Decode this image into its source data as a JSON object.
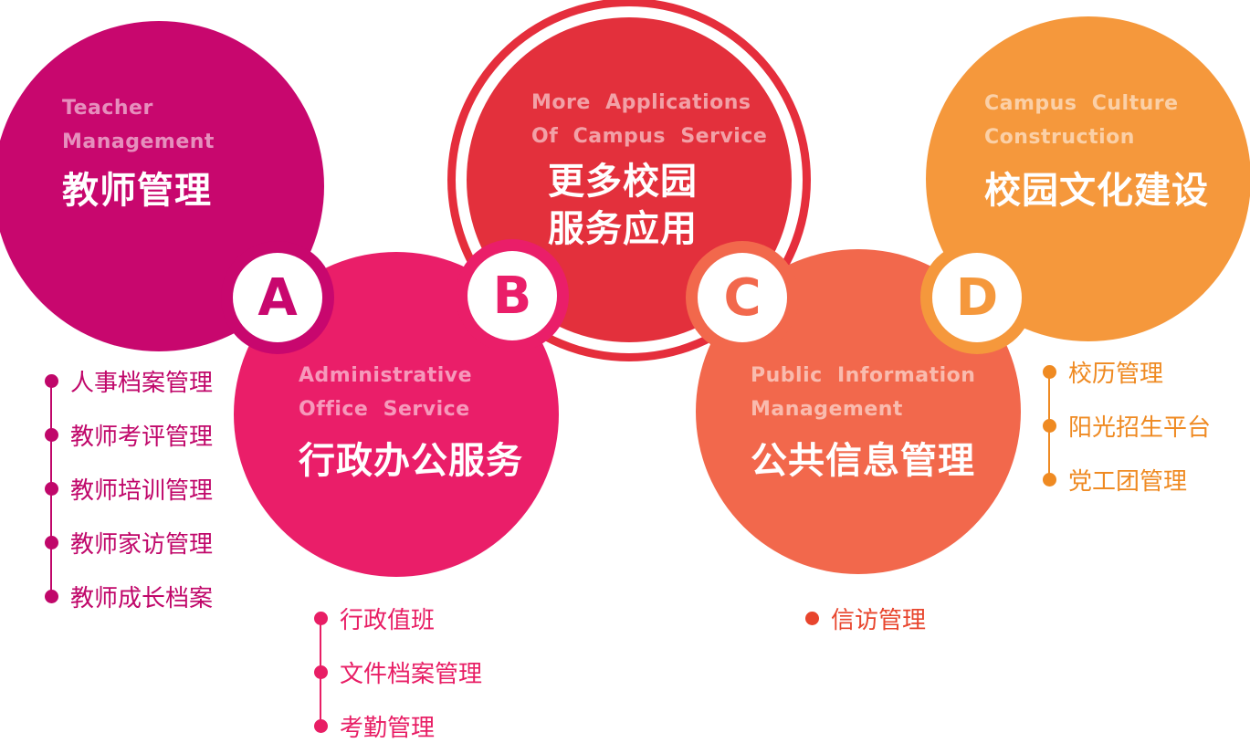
{
  "colors": {
    "a": "#c8076e",
    "b": "#ea1e69",
    "c_outer": "#e52e3c",
    "c": "#e3303c",
    "d": "#f2684c",
    "e": "#f5983c",
    "list_a": "#c0076a",
    "list_b": "#e81e65",
    "list_c": "#e8452d",
    "list_d": "#ef8a22"
  },
  "sections": {
    "a": {
      "en_lines": [
        "Teacher",
        "Management"
      ],
      "title_lines": [
        "教师管理"
      ],
      "badge": "A",
      "items": [
        "人事档案管理",
        "教师考评管理",
        "教师培训管理",
        "教师家访管理",
        "教师成长档案"
      ]
    },
    "b": {
      "en_lines": [
        "Administrative",
        "Office  Service"
      ],
      "title_lines": [
        "行政办公服务"
      ],
      "badge": "B",
      "items": [
        "行政值班",
        "文件档案管理",
        "考勤管理"
      ]
    },
    "c": {
      "en_lines": [
        "More  Applications",
        "Of  Campus  Service"
      ],
      "title_lines": [
        "更多校园",
        "服务应用"
      ],
      "badge": "C"
    },
    "d": {
      "en_lines": [
        "Public  Information",
        "Management"
      ],
      "title_lines": [
        "公共信息管理"
      ],
      "badge": "D",
      "items": [
        "信访管理"
      ]
    },
    "e": {
      "en_lines": [
        "Campus  Culture",
        "Construction"
      ],
      "title_lines": [
        "校园文化建设"
      ],
      "items": [
        "校历管理",
        "阳光招生平台",
        "党工团管理"
      ]
    }
  }
}
